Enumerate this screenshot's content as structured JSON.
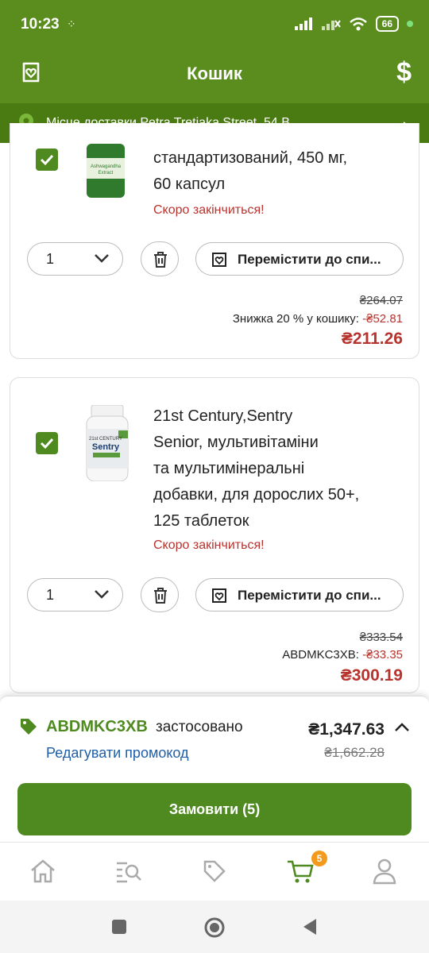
{
  "status": {
    "time": "10:23",
    "battery": "66"
  },
  "header": {
    "title": "Кошик"
  },
  "delivery": {
    "text": "Місце доставки Petra Tretiaka Street, 54 B"
  },
  "items": [
    {
      "title_lines": [
        "стандартизований, 450 мг,",
        "60 капсул"
      ],
      "stock_note": "Скоро закінчиться!",
      "quantity": "1",
      "move_label": "Перемістити до спи...",
      "old_price": "₴264.07",
      "discount_label": "Знижка 20 % у кошику: ",
      "discount_value": "-₴52.81",
      "price": "₴211.26",
      "bottle_label": "Ashwagandha Extract"
    },
    {
      "title_lines": [
        "21st Century,Sentry",
        "Senior, мультивітаміни",
        "та мультимінеральні",
        "добавки, для дорослих 50+,",
        "125 таблеток"
      ],
      "stock_note": "Скоро закінчиться!",
      "quantity": "1",
      "move_label": "Перемістити до спи...",
      "old_price": "₴333.54",
      "discount_label": "ABDMKC3XB: ",
      "discount_value": "-₴33.35",
      "price": "₴300.19",
      "bottle_label": "Sentry"
    }
  ],
  "summary": {
    "promo_code": "ABDMKC3XB",
    "promo_applied": "застосовано",
    "edit_promo": "Редагувати промокод",
    "total": "₴1,347.63",
    "total_old": "₴1,662.28",
    "order_button": "Замовити (5)"
  },
  "nav": {
    "cart_badge": "5"
  },
  "colors": {
    "brand": "#5a8d1e",
    "brand_dark": "#4a7a12",
    "price_red": "#b8332e",
    "link_blue": "#1f5fa8",
    "badge_orange": "#f29a1b"
  }
}
